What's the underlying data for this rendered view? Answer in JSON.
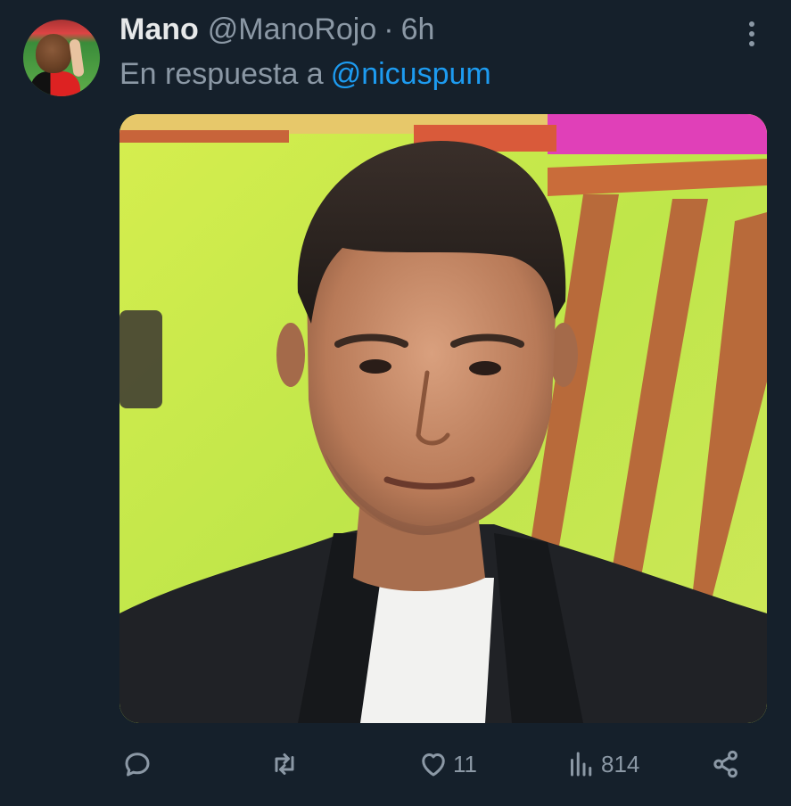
{
  "tweet": {
    "display_name": "Mano",
    "handle": "@ManoRojo",
    "separator": "·",
    "time": "6h",
    "reply_prefix": "En respuesta a",
    "reply_to": "@nicuspum"
  },
  "actions": {
    "likes": "11",
    "views": "814"
  },
  "colors": {
    "background": "#15202b",
    "primary_text": "#e7e9ea",
    "secondary_text": "#8b98a5",
    "link": "#1d9bf0"
  },
  "icons": {
    "more": "more-vertical-icon",
    "reply": "reply-icon",
    "retweet": "retweet-icon",
    "like": "heart-icon",
    "views": "views-bar-chart-icon",
    "share": "share-icon"
  }
}
